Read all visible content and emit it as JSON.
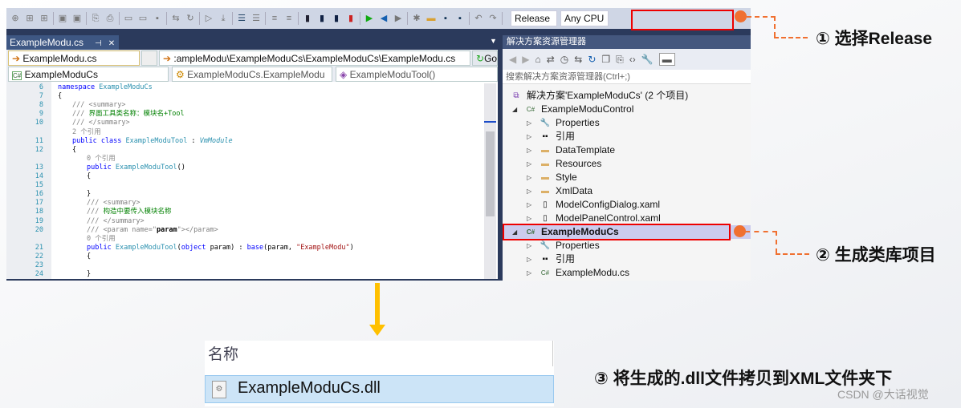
{
  "toolbar": {
    "config": "Release",
    "platform": "Any CPU"
  },
  "editor": {
    "tab": "ExampleModu.cs",
    "tab_pin": "⊣",
    "tab_close": "✕",
    "file_combo": "ExampleModu.cs",
    "path_combo": ":ampleModu\\ExampleModuCs\\ExampleModuCs\\ExampleModu.cs",
    "go": "Go",
    "project_combo": "ExampleModuCs",
    "class_combo": "ExampleModuCs.ExampleModu",
    "member_combo": "ExampleModuTool()",
    "lines": [
      {
        "n": "6",
        "html": "<span class='kw'>namespace</span> <span class='ty'>ExampleModuCs</span>",
        "i": 0
      },
      {
        "n": "7",
        "html": "{",
        "i": 0
      },
      {
        "n": "8",
        "html": "<span class='cm'>/// &lt;summary&gt;</span>",
        "i": 2
      },
      {
        "n": "9",
        "html": "<span class='cm'>///</span> <span class='gr'>界面工具类名称：模块名+Tool</span>",
        "i": 2
      },
      {
        "n": "10",
        "html": "<span class='cm'>/// &lt;/summary&gt;</span>",
        "i": 2
      },
      {
        "n": "",
        "html": "<span class='ref'>2 个引用</span>",
        "i": 2
      },
      {
        "n": "11",
        "html": "<span class='kw'>public class</span> <span class='ty'>ExampleModuTool</span> : <i class='ty'>VmModule</i>",
        "i": 2
      },
      {
        "n": "12",
        "html": "{",
        "i": 2
      },
      {
        "n": "",
        "html": "<span class='ref'>0 个引用</span>",
        "i": 4
      },
      {
        "n": "13",
        "html": "<span class='kw'>public</span> <span class='ty'>ExampleModuTool</span>()",
        "i": 4
      },
      {
        "n": "14",
        "html": "{",
        "i": 4
      },
      {
        "n": "15",
        "html": "",
        "i": 4
      },
      {
        "n": "16",
        "html": "}",
        "i": 4
      },
      {
        "n": "17",
        "html": "<span class='cm'>/// &lt;summary&gt;</span>",
        "i": 4
      },
      {
        "n": "18",
        "html": "<span class='cm'>///</span> <span class='gr'>构造中要传入模块名称</span>",
        "i": 4
      },
      {
        "n": "19",
        "html": "<span class='cm'>/// &lt;/summary&gt;</span>",
        "i": 4
      },
      {
        "n": "20",
        "html": "<span class='cm'>/// &lt;param name=\"</span><b>param</b><span class='cm'>\"&gt;&lt;/param&gt;</span>",
        "i": 4
      },
      {
        "n": "",
        "html": "<span class='ref'>0 个引用</span>",
        "i": 4
      },
      {
        "n": "21",
        "html": "<span class='kw'>public</span> <span class='ty'>ExampleModuTool</span>(<span class='kw'>object</span> param) : <span class='kw'>base</span>(param, <span class='st'>\"ExampleModu\"</span>)",
        "i": 4
      },
      {
        "n": "22",
        "html": "{",
        "i": 4
      },
      {
        "n": "23",
        "html": "",
        "i": 4
      },
      {
        "n": "24",
        "html": "}",
        "i": 4
      }
    ]
  },
  "solution_explorer": {
    "title": "解决方案资源管理器",
    "search_placeholder": "搜索解决方案资源管理器(Ctrl+;)",
    "items": [
      {
        "label": "解决方案'ExampleModuCs' (2 个项目)",
        "icon": "solution-icon",
        "glyph": "⧉",
        "level": 0,
        "exp": ""
      },
      {
        "label": "ExampleModuControl",
        "icon": "csharp-project-icon",
        "glyph": "C#",
        "level": 1,
        "exp": "◢"
      },
      {
        "label": "Properties",
        "icon": "wrench-icon",
        "glyph": "🔧",
        "level": 2,
        "exp": "▷"
      },
      {
        "label": "引用",
        "icon": "references-icon",
        "glyph": "▪▪",
        "level": 2,
        "exp": "▷"
      },
      {
        "label": "DataTemplate",
        "icon": "folder-icon",
        "glyph": "▬",
        "level": 2,
        "exp": "▷"
      },
      {
        "label": "Resources",
        "icon": "folder-icon",
        "glyph": "▬",
        "level": 2,
        "exp": "▷"
      },
      {
        "label": "Style",
        "icon": "folder-icon",
        "glyph": "▬",
        "level": 2,
        "exp": "▷"
      },
      {
        "label": "XmlData",
        "icon": "folder-icon",
        "glyph": "▬",
        "level": 2,
        "exp": "▷"
      },
      {
        "label": "ModelConfigDialog.xaml",
        "icon": "xaml-file-icon",
        "glyph": "▯",
        "level": 2,
        "exp": "▷"
      },
      {
        "label": "ModelPanelControl.xaml",
        "icon": "xaml-file-icon",
        "glyph": "▯",
        "level": 2,
        "exp": "▷"
      },
      {
        "label": "ExampleModuCs",
        "icon": "csharp-project-icon",
        "glyph": "C#",
        "level": 1,
        "exp": "◢",
        "selected": true
      },
      {
        "label": "Properties",
        "icon": "wrench-icon",
        "glyph": "🔧",
        "level": 2,
        "exp": "▷"
      },
      {
        "label": "引用",
        "icon": "references-icon",
        "glyph": "▪▪",
        "level": 2,
        "exp": "▷"
      },
      {
        "label": "ExampleModu.cs",
        "icon": "csharp-file-icon",
        "glyph": "C#",
        "level": 2,
        "exp": "▷"
      }
    ]
  },
  "file_list": {
    "header": "名称",
    "file": "ExampleModuCs.dll"
  },
  "steps": {
    "step1": "① 选择Release",
    "step2": "② 生成类库项目",
    "step3": "③ 将生成的.dll文件拷贝到XML文件夹下"
  },
  "watermark": "CSDN @大话视觉",
  "colors": {
    "highlight": "#e00000",
    "accent": "#f07030",
    "arrow": "#ffc000"
  }
}
